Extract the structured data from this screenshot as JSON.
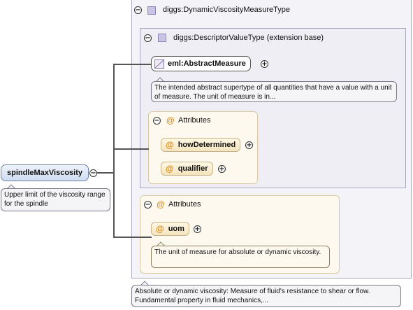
{
  "root_element": {
    "name": "spindleMaxViscosity",
    "documentation": "Upper limit of the viscosity range for the spindle",
    "collapse_symbol": "−"
  },
  "outer_type": {
    "name": "diggs:DynamicViscosityMeasureType",
    "documentation": "Absolute or dynamic viscosity: Measure of fluid's resistance to shear or flow. Fundamental property in fluid mechanics,...",
    "collapse_symbol": "−"
  },
  "base_type": {
    "name": "diggs:DescriptorValueType (extension base)",
    "collapse_symbol": "−",
    "abstract_element": {
      "name": "eml:AbstractMeasure",
      "documentation": "The intended abstract supertype of all quantities that have a value with a unit of measure. The unit of measure is in...",
      "expand_symbol": "+"
    },
    "attributes": {
      "label": "Attributes",
      "collapse_symbol": "−",
      "items": [
        {
          "name": "howDetermined",
          "expand_symbol": "+"
        },
        {
          "name": "qualifier",
          "expand_symbol": "+"
        }
      ]
    }
  },
  "own_attributes": {
    "label": "Attributes",
    "collapse_symbol": "−",
    "items": [
      {
        "name": "uom",
        "expand_symbol": "+",
        "documentation": "The unit of measure for absolute or dynamic viscosity."
      }
    ]
  },
  "icons": {
    "type_icon": "complex-type-icon",
    "attribute_icon": "at-sign",
    "abstract_icon": "abstract-element-icon"
  },
  "colors": {
    "element_fill": "#cfdcf1",
    "type_fill": "#f4f4f8",
    "attribute_fill": "#f5e4bd",
    "attribute_symbol": "#d98b1d"
  }
}
